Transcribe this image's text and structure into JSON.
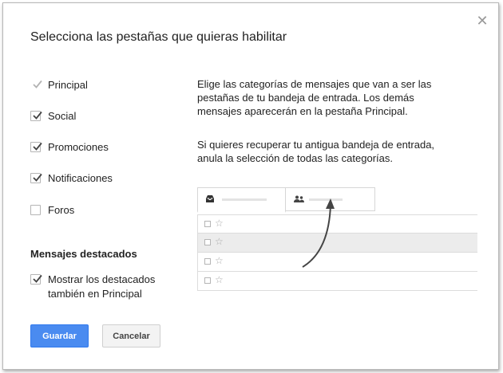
{
  "dialog": {
    "title": "Selecciona las pestañas que quieras habilitar",
    "close_icon": "close-icon"
  },
  "categories": [
    {
      "label": "Principal",
      "checked": true,
      "disabled": true
    },
    {
      "label": "Social",
      "checked": true,
      "disabled": false
    },
    {
      "label": "Promociones",
      "checked": true,
      "disabled": false
    },
    {
      "label": "Notificaciones",
      "checked": true,
      "disabled": false
    },
    {
      "label": "Foros",
      "checked": false,
      "disabled": false
    }
  ],
  "starred": {
    "section_title": "Mensajes destacados",
    "label": "Mostrar los destacados también en Principal",
    "checked": true
  },
  "description": {
    "paragraph1": "Elige las categorías de mensajes que van a ser las pestañas de tu bandeja de entrada. Los demás mensajes aparecerán en la pestaña Principal.",
    "paragraph2": "Si quieres recuperar tu antigua bandeja de entrada, anula la selección de todas las categorías."
  },
  "preview": {
    "tab_icons": [
      "inbox-icon",
      "people-icon"
    ],
    "row_count": 4,
    "star_glyph": "☆"
  },
  "buttons": {
    "save_label": "Guardar",
    "cancel_label": "Cancelar"
  },
  "colors": {
    "primary_button": "#4a8bf0",
    "check_mark": "#444444",
    "disabled_check": "#b3b3b3"
  }
}
